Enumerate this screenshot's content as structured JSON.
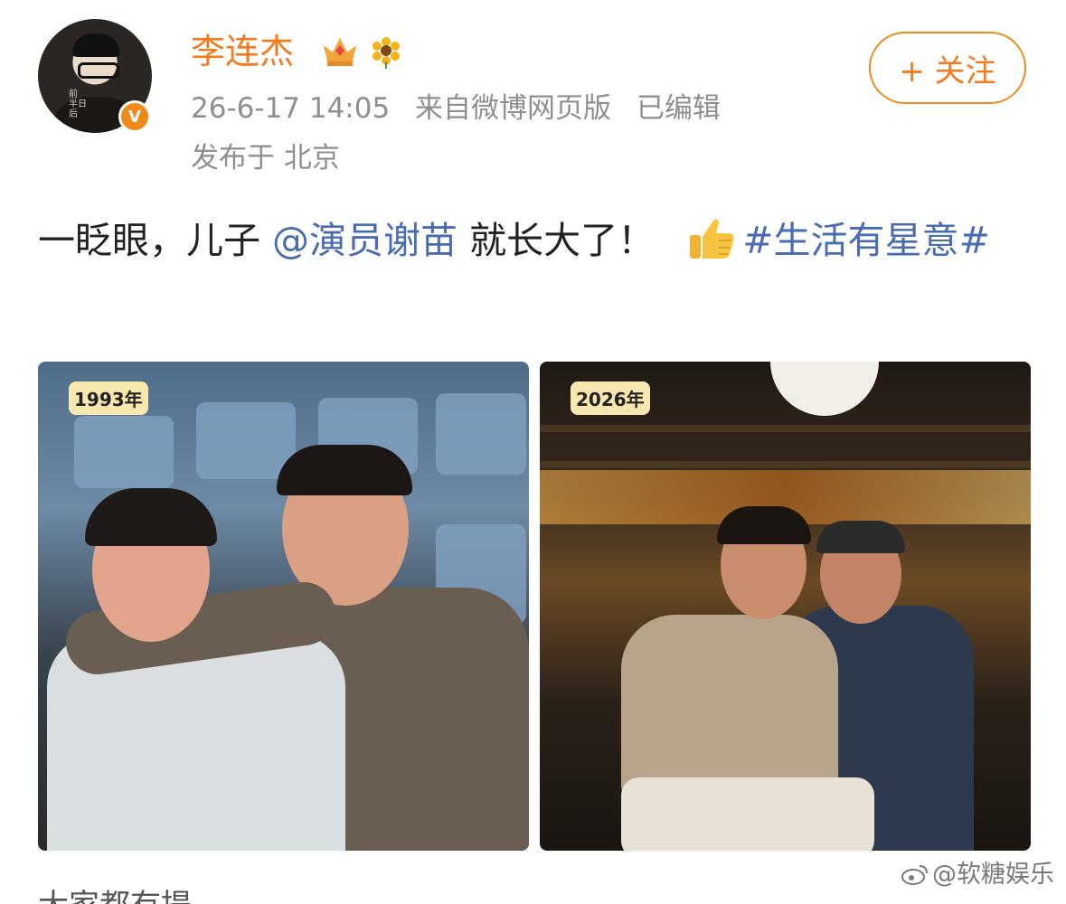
{
  "post": {
    "author": "李连杰",
    "timestamp": "26-6-17 14:05",
    "source": "来自微博网页版",
    "edited": "已编辑",
    "location": "发布于 北京",
    "follow_label": "+ 关注",
    "verified_badge": "V",
    "avatar_caption": [
      "前",
      "半日",
      "后"
    ]
  },
  "content": {
    "text_before": "一眨眼，儿子",
    "mention": "@演员谢苗",
    "text_after": " 就长大了！",
    "emoji": "thumbs-up-icon",
    "hashtag": "#生活有星意#"
  },
  "photos": [
    {
      "year_label": "1993年"
    },
    {
      "year_label": "2026年"
    }
  ],
  "watermark": "@软糖娱乐",
  "cut_text": "大家都有提",
  "colors": {
    "username": "#f37b1d",
    "link": "#4a6db0",
    "meta": "#8f8f8f",
    "accent": "#f08a1b"
  }
}
